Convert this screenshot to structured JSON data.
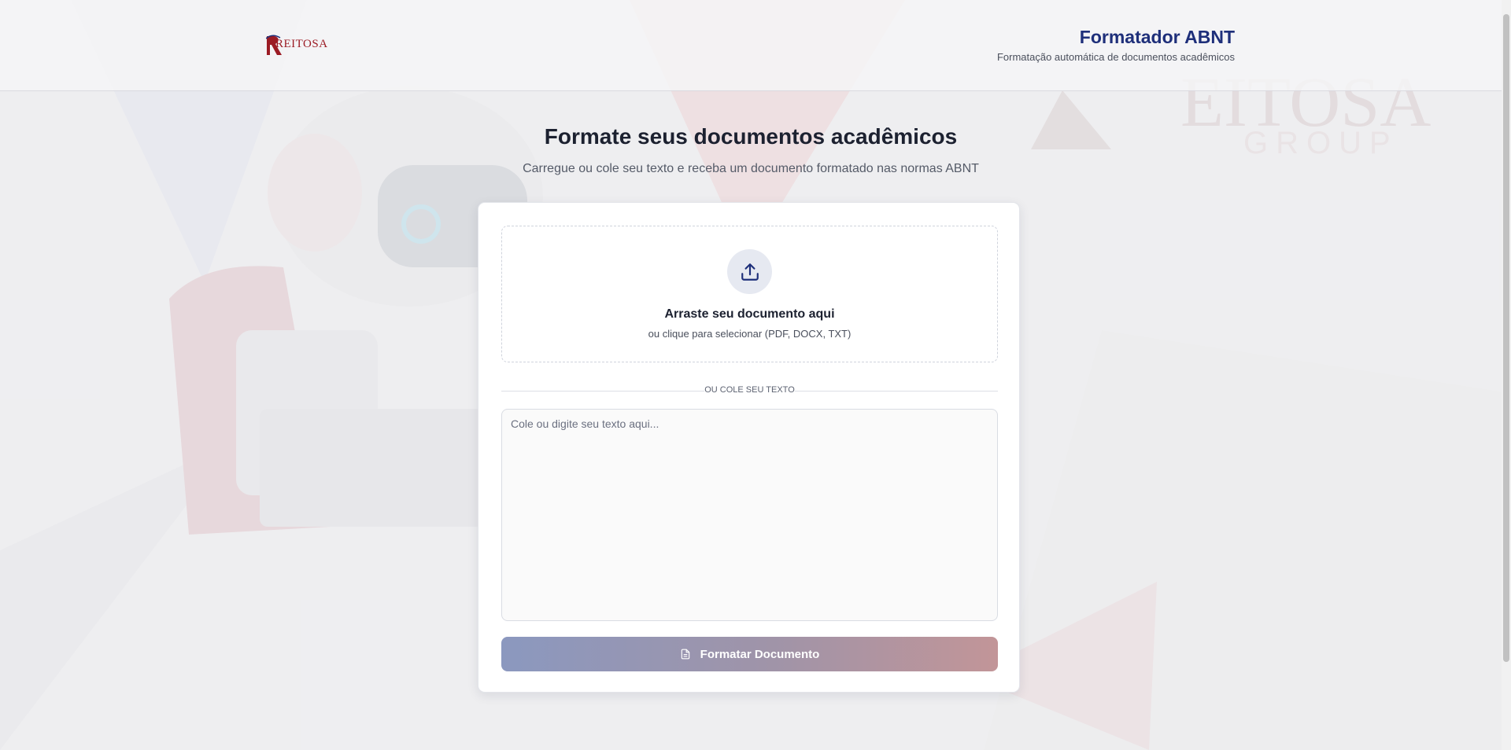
{
  "header": {
    "logo_text": "REITOSA",
    "title": "Formatador ABNT",
    "subtitle": "Formatação automática de documentos acadêmicos"
  },
  "hero": {
    "title": "Formate seus documentos acadêmicos",
    "subtitle": "Carregue ou cole seu texto e receba um documento formatado nas normas ABNT"
  },
  "upload": {
    "icon": "upload-icon",
    "title": "Arraste seu documento aqui",
    "subtitle": "ou clique para selecionar (PDF, DOCX, TXT)"
  },
  "divider_label": "OU COLE SEU TEXTO",
  "text_input": {
    "placeholder": "Cole ou digite seu texto aqui...",
    "value": ""
  },
  "submit": {
    "icon": "document-icon",
    "label": "Formatar Documento"
  },
  "colors": {
    "brand_navy": "#1e2f7a",
    "brand_red": "#9b1b24",
    "button_gradient_start": "#8b98bf",
    "button_gradient_end": "#c29598"
  }
}
